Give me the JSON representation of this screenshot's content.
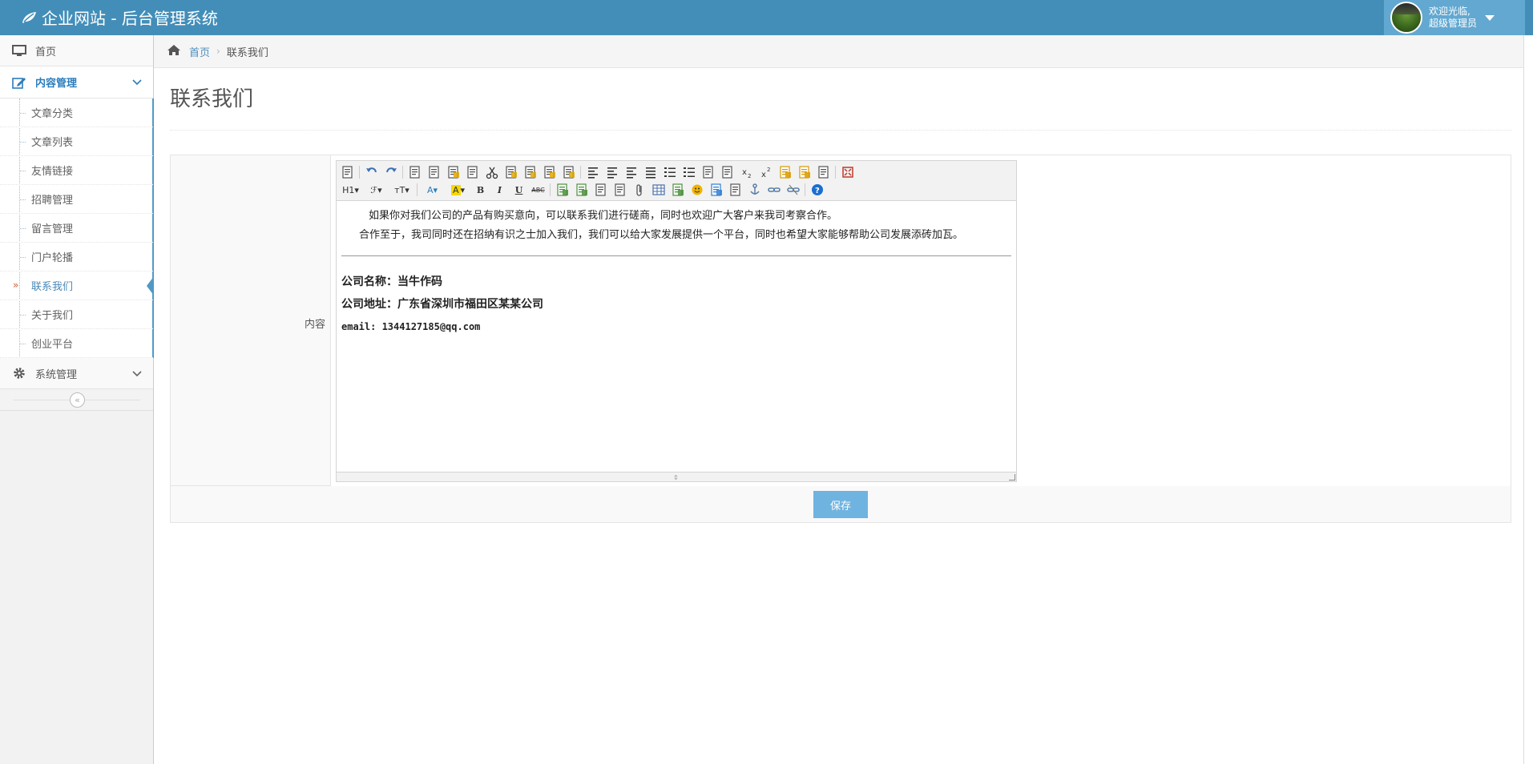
{
  "navbar": {
    "brand": "企业网站 - 后台管理系统",
    "welcome": "欢迎光临,",
    "username": "超级管理员"
  },
  "sidebar": {
    "home": "首页",
    "content_menu": "内容管理",
    "content_items": [
      "文章分类",
      "文章列表",
      "友情链接",
      "招聘管理",
      "留言管理",
      "门户轮播",
      "联系我们",
      "关于我们",
      "创业平台"
    ],
    "active_index": 6,
    "system_menu": "系统管理",
    "collapse_glyph": "«"
  },
  "breadcrumb": {
    "home": "首页",
    "current": "联系我们"
  },
  "page": {
    "title": "联系我们"
  },
  "form": {
    "content_label": "内容",
    "save_label": "保存"
  },
  "editor": {
    "toolbar_row2_text": {
      "heading": "H1",
      "font": "ℱ",
      "size": "ᴛT",
      "bold": "B",
      "italic": "I",
      "underline": "U",
      "abc": "ABC"
    },
    "paragraph1": "如果你对我们公司的产品有购买意向，可以联系我们进行磋商，同时也欢迎广大客户来我司考察合作。",
    "paragraph2": "合作至于，我司同时还在招纳有识之士加入我们，我们可以给大家发展提供一个平台，同时也希望大家能够帮助公司发展添砖加瓦。",
    "company_name": "公司名称：当牛作码",
    "company_address": "公司地址：广东省深圳市福田区某某公司",
    "email": "email: 1344127185@qq.com"
  },
  "colors": {
    "navbar": "#438eb9",
    "user_area": "#62a8d1",
    "accent": "#2b7dbc",
    "save_button": "#6fb3e0"
  }
}
